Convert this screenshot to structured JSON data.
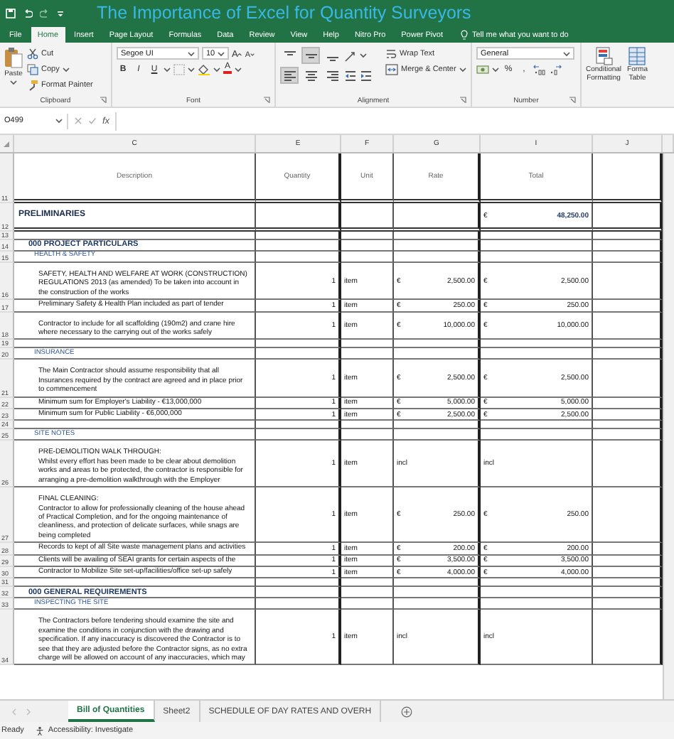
{
  "title_bar": {
    "title": "The Importance of Excel for Quantity Surveyors"
  },
  "ribbon_tabs": [
    {
      "label": "File",
      "selected": false
    },
    {
      "label": "Home",
      "selected": true
    },
    {
      "label": "Insert",
      "selected": false
    },
    {
      "label": "Page Layout",
      "selected": false
    },
    {
      "label": "Formulas",
      "selected": false
    },
    {
      "label": "Data",
      "selected": false
    },
    {
      "label": "Review",
      "selected": false
    },
    {
      "label": "View",
      "selected": false
    },
    {
      "label": "Help",
      "selected": false
    },
    {
      "label": "Nitro Pro",
      "selected": false
    },
    {
      "label": "Power Pivot",
      "selected": false
    }
  ],
  "tell_me": "Tell me what you want to do",
  "clipboard": {
    "paste": "Paste",
    "cut": "Cut",
    "copy": "Copy",
    "format_painter": "Format Painter",
    "label": "Clipboard"
  },
  "font": {
    "name": "Segoe UI",
    "size": "10",
    "grow": "A",
    "shrink": "A",
    "styles": [
      {
        "kind": "bold",
        "label": "B"
      },
      {
        "kind": "italic",
        "label": "I"
      },
      {
        "kind": "underline",
        "label": "U"
      }
    ],
    "color_label": "A",
    "label": "Font"
  },
  "alignment": {
    "vertical": [
      {
        "kind": "top",
        "selected": false
      },
      {
        "kind": "middle",
        "selected": true
      },
      {
        "kind": "bottom",
        "selected": false
      }
    ],
    "horizontal": [
      {
        "kind": "left",
        "selected": true
      },
      {
        "kind": "center",
        "selected": false
      },
      {
        "kind": "right",
        "selected": false
      }
    ],
    "wrap_text": "Wrap Text",
    "merge": "Merge & Center",
    "label": "Alignment"
  },
  "number": {
    "format": "General",
    "percent": "%",
    "comma": ",",
    "label": "Number"
  },
  "styles": [
    {
      "kind": "conditional",
      "lines": [
        "Conditional",
        "Formatting"
      ]
    },
    {
      "kind": "table",
      "lines": [
        "Forma",
        "Table"
      ]
    }
  ],
  "formula_bar": {
    "name_box": "O499",
    "function_label": "fx"
  },
  "columns": [
    "C",
    "E",
    "F",
    "G",
    "I",
    "J"
  ],
  "rows": [
    {
      "num": "11",
      "kind": "header",
      "description": "Description",
      "quantity": "Quantity",
      "unit": "Unit",
      "rate": "Rate",
      "total": "Total"
    },
    {
      "num": "12",
      "kind": "summary",
      "description": "PRELIMINARIES",
      "total_symbol": "€",
      "total": "48,250.00"
    },
    {
      "num": "13",
      "kind": "blank"
    },
    {
      "num": "14",
      "kind": "group",
      "description": "000 PROJECT PARTICULARS"
    },
    {
      "num": "15",
      "kind": "subgroup",
      "description": "HEALTH & SAFETY"
    },
    {
      "num": "16",
      "kind": "item",
      "description": "SAFETY, HEALTH AND WELFARE AT WORK (CONSTRUCTION) REGULATIONS 2013 (as amended) To be taken into account in the construction of the works",
      "quantity": "1",
      "unit": "item",
      "rate_symbol": "€",
      "rate": "2,500.00",
      "total_symbol": "€",
      "total": "2,500.00"
    },
    {
      "num": "17",
      "kind": "item",
      "description": "Preliminary Safety & Health Plan included as part of tender",
      "quantity": "1",
      "unit": "item",
      "rate_symbol": "€",
      "rate": "250.00",
      "total_symbol": "€",
      "total": "250.00"
    },
    {
      "num": "18",
      "kind": "item",
      "description": "Contractor to include for all scaffolding (190m2) and crane hire where necessary to the carrying out of the works safely",
      "quantity": "1",
      "unit": "item",
      "rate_symbol": "€",
      "rate": "10,000.00",
      "total_symbol": "€",
      "total": "10,000.00"
    },
    {
      "num": "19",
      "kind": "blank"
    },
    {
      "num": "20",
      "kind": "subgroup",
      "description": "INSURANCE"
    },
    {
      "num": "21",
      "kind": "item",
      "description": "The Main Contractor should assume responsibility that all Insurances required by the contract are agreed and in place prior to commencement",
      "quantity": "1",
      "unit": "item",
      "rate_symbol": "€",
      "rate": "2,500.00",
      "total_symbol": "€",
      "total": "2,500.00"
    },
    {
      "num": "22",
      "kind": "item",
      "description": "Minimum sum for Employer's Liability - €13,000,000",
      "quantity": "1",
      "unit": "item",
      "rate_symbol": "€",
      "rate": "5,000.00",
      "total_symbol": "€",
      "total": "5,000.00"
    },
    {
      "num": "23",
      "kind": "item",
      "description": "Minimum sum for Public Liability - €6,000,000",
      "quantity": "1",
      "unit": "item",
      "rate_symbol": "€",
      "rate": "2,500.00",
      "total_symbol": "€",
      "total": "2,500.00"
    },
    {
      "num": "24",
      "kind": "blank"
    },
    {
      "num": "25",
      "kind": "subgroup",
      "description": "SITE NOTES"
    },
    {
      "num": "26",
      "kind": "item",
      "heading": "PRE-DEMOLITION WALK THROUGH:",
      "description": "Whilst every effort has been made to be clear about demolition works and areas to be protected, the contractor is responsible for arranging a pre-demolition walkthrough with the Employer",
      "quantity": "1",
      "unit": "item",
      "rate": "incl",
      "total": "incl"
    },
    {
      "num": "27",
      "kind": "item",
      "heading": "FINAL CLEANING:",
      "description": "Contractor to allow for professionally cleaning of the house ahead of Practical Completion, and for the ongoing maintenance of cleanliness, and protection of delicate surfaces, while snags are being completed",
      "quantity": "1",
      "unit": "item",
      "rate_symbol": "€",
      "rate": "250.00",
      "total_symbol": "€",
      "total": "250.00"
    },
    {
      "num": "28",
      "kind": "item",
      "description": "Records to kept of all Site waste management plans and activities",
      "quantity": "1",
      "unit": "item",
      "rate_symbol": "€",
      "rate": "200.00",
      "total_symbol": "€",
      "total": "200.00"
    },
    {
      "num": "29",
      "kind": "item",
      "description": "Clients will be availing of SEAI grants for certain aspects of the",
      "quantity": "1",
      "unit": "item",
      "rate_symbol": "€",
      "rate": "3,500.00",
      "total_symbol": "€",
      "total": "3,500.00"
    },
    {
      "num": "30",
      "kind": "item",
      "description": "Contractor to Mobilize Site set-up/facilities/office set-up safely",
      "quantity": "1",
      "unit": "item",
      "rate_symbol": "€",
      "rate": "4,000.00",
      "total_symbol": "€",
      "total": "4,000.00"
    },
    {
      "num": "31",
      "kind": "blank"
    },
    {
      "num": "32",
      "kind": "group",
      "description": "000 GENERAL REQUIREMENTS"
    },
    {
      "num": "33",
      "kind": "subgroup",
      "description": "INSPECTING THE SITE"
    },
    {
      "num": "34",
      "kind": "item",
      "description": "The Contractors before tendering should examine the site and examine the conditions in conjunction with the drawing and specification. If any inaccuracy is discovered the Contractor is to see that they are adjusted before the Contractor signs, as no extra charge will be allowed on account of any inaccuracies, which may",
      "quantity": "1",
      "unit": "item",
      "rate": "incl",
      "total": "incl"
    }
  ],
  "sheet_tabs": [
    {
      "label": "Bill of Quantities",
      "selected": true
    },
    {
      "label": "Sheet2",
      "selected": false
    },
    {
      "label": "SCHEDULE OF DAY RATES AND OVERH",
      "selected": false
    }
  ],
  "status_bar": {
    "status": "Ready",
    "accessibility": "Accessibility: Investigate"
  }
}
